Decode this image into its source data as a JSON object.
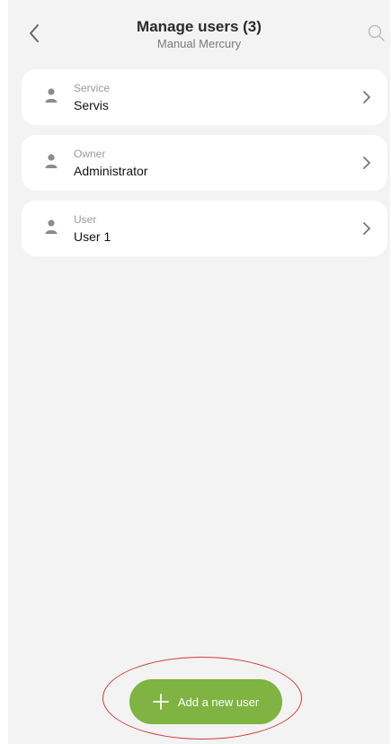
{
  "header": {
    "title": "Manage users (3)",
    "subtitle": "Manual Mercury"
  },
  "users": [
    {
      "role": "Service",
      "name": "Servis"
    },
    {
      "role": "Owner",
      "name": "Administrator"
    },
    {
      "role": "User",
      "name": "User 1"
    }
  ],
  "add_button": {
    "label": "Add a new user"
  },
  "colors": {
    "accent": "#7fb342",
    "highlight_ring": "#d23a3a"
  },
  "icons": [
    "back-chevron-icon",
    "search-icon",
    "person-icon",
    "chevron-right-icon",
    "plus-icon"
  ]
}
